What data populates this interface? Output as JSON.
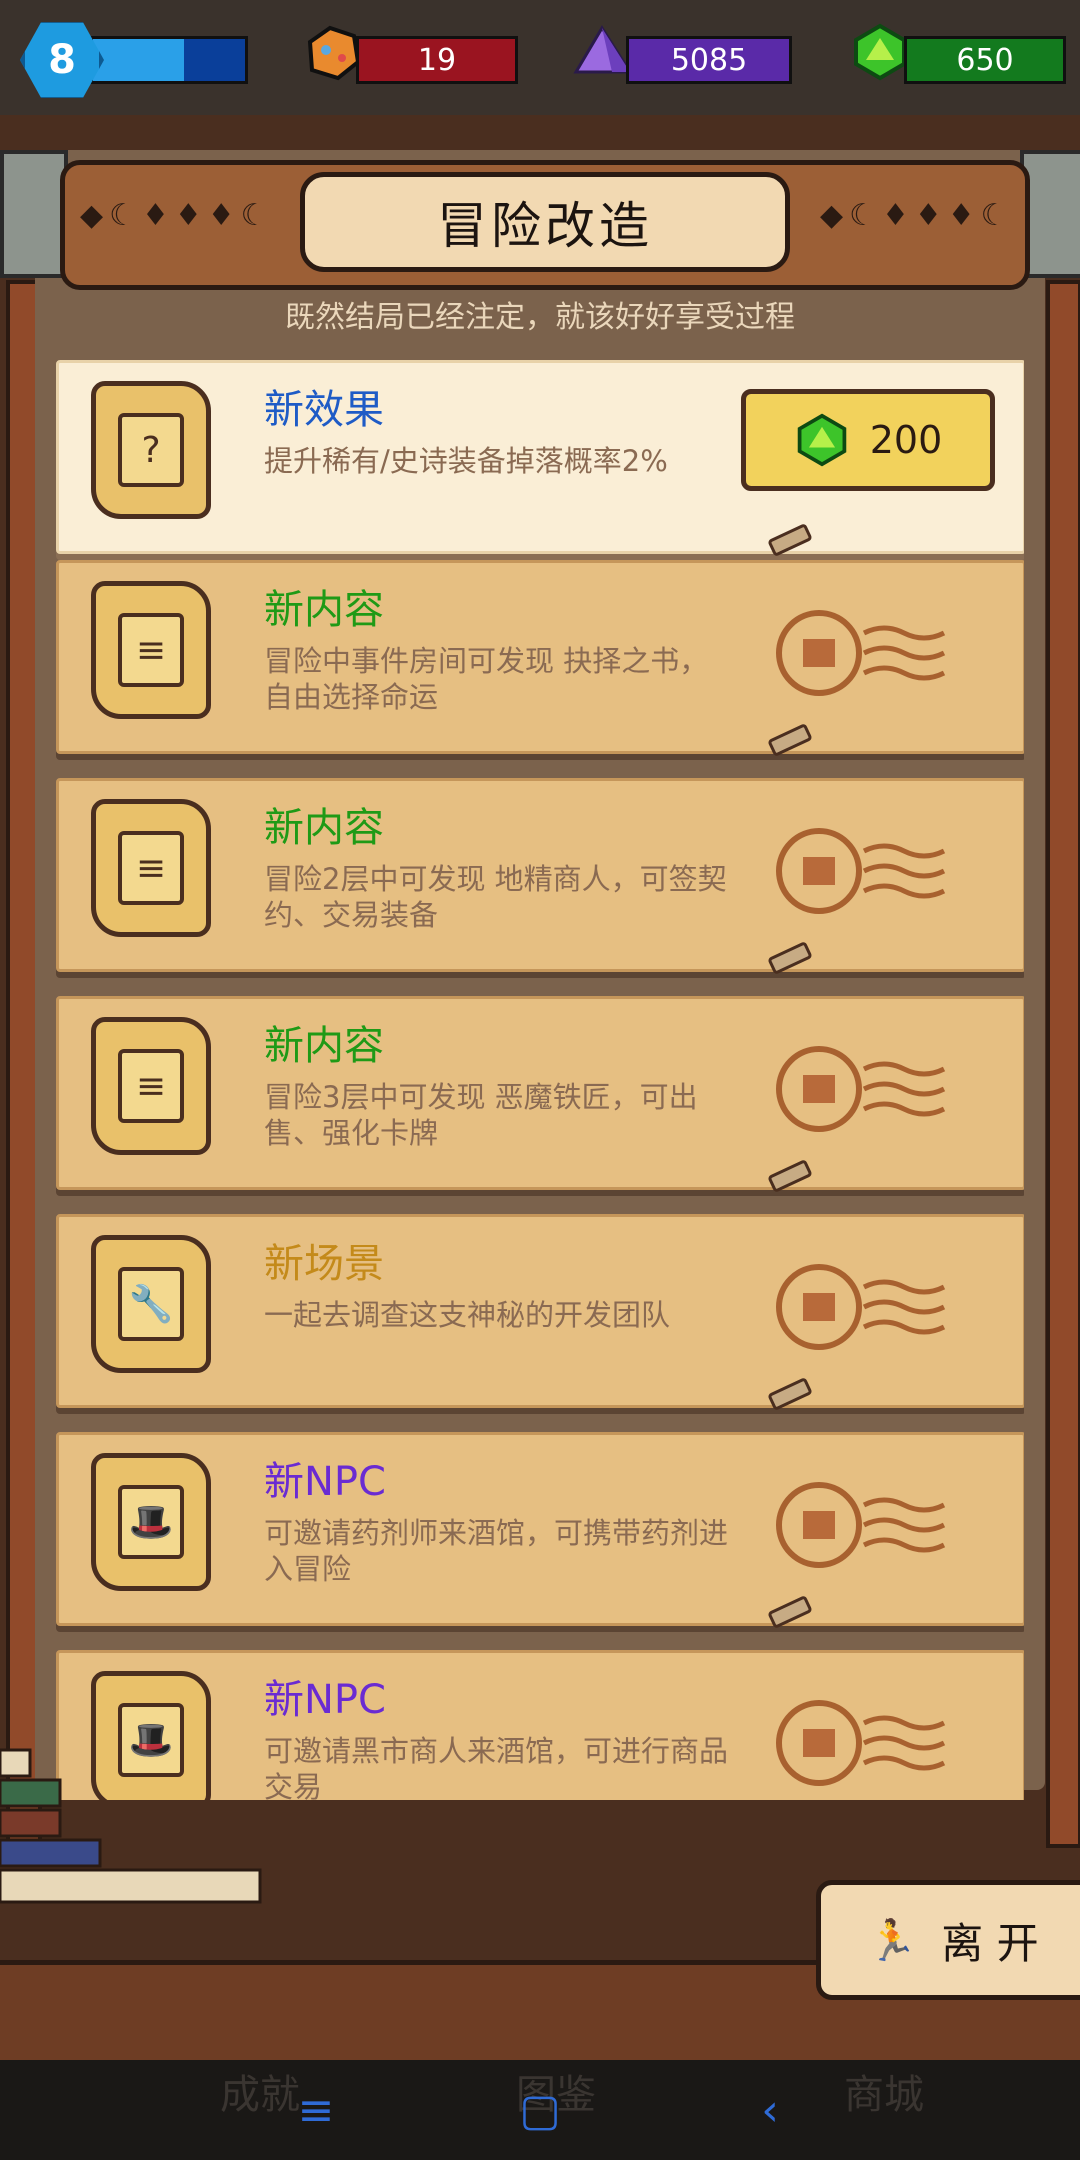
{
  "resources": {
    "level": "8",
    "xp_fraction": 0.6,
    "gold": "19",
    "crystal": "5085",
    "gem": "650"
  },
  "board": {
    "title": "冒险改造",
    "subtitle": "既然结局已经注定，就该好好享受过程"
  },
  "cards": [
    {
      "title": "新效果",
      "desc": "提升稀有/史诗装备掉落概率2%",
      "price": "200",
      "color": "#1e5bc6",
      "glyph": "?"
    },
    {
      "title": "新内容",
      "desc": "冒险中事件房间可发现 抉择之书，自由选择命运",
      "color": "#1f9a16",
      "glyph": "≡"
    },
    {
      "title": "新内容",
      "desc": "冒险2层中可发现 地精商人，可签契约、交易装备",
      "color": "#1f9a16",
      "glyph": "≡"
    },
    {
      "title": "新内容",
      "desc": "冒险3层中可发现 恶魔铁匠，可出售、强化卡牌",
      "color": "#1f9a16",
      "glyph": "≡"
    },
    {
      "title": "新场景",
      "desc": "一起去调查这支神秘的开发团队",
      "color": "#c48a1a",
      "glyph": "🔧"
    },
    {
      "title": "新NPC",
      "desc": "可邀请药剂师来酒馆，可携带药剂进入冒险",
      "color": "#6a2bd2",
      "glyph": "🎩"
    },
    {
      "title": "新NPC",
      "desc": "可邀请黑市商人来酒馆，可进行商品交易",
      "color": "#6a2bd2",
      "glyph": "🎩"
    }
  ],
  "exit_label": "离 开",
  "bottom_tabs": [
    "成就",
    "图鉴",
    "商城"
  ],
  "nav": {
    "menu": "≡",
    "home": "▢",
    "back": "‹"
  },
  "colors": {
    "blue": "#1e5bc6",
    "green": "#1f9a16",
    "orange": "#c48a1a",
    "purple": "#6a2bd2"
  }
}
